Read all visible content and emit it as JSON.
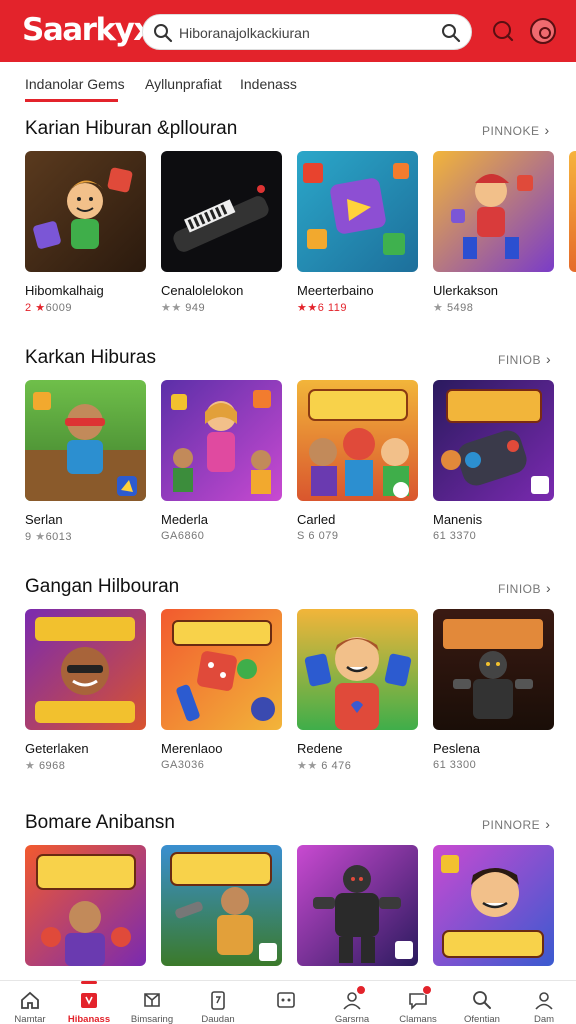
{
  "header": {
    "logo": "Saarkyx",
    "search_placeholder": "Hiboranajolkackiuran",
    "accent_color": "#e3232b"
  },
  "tabs": [
    {
      "label": "Indanolar Gems",
      "active": true
    },
    {
      "label": "Ayllunprafiat",
      "active": false
    },
    {
      "label": "Indenass",
      "active": false
    }
  ],
  "sections": [
    {
      "title": "Karian Hiburan &pllouran",
      "more": "PINNOKE",
      "items": [
        {
          "name": "Hibomkalhaig",
          "rating": "2",
          "meta": "6009",
          "red": true
        },
        {
          "name": "Cenalolelokon",
          "rating": "",
          "meta": "949",
          "red": false
        },
        {
          "name": "Meerterbaino",
          "rating": "",
          "meta": "6 119",
          "red": true
        },
        {
          "name": "Ulerkakson",
          "rating": "",
          "meta": "5498",
          "red": false
        }
      ]
    },
    {
      "title": "Karkan Hiburas",
      "more": "FINIOB",
      "items": [
        {
          "name": "Serlan",
          "rating": "9",
          "meta": "6013",
          "red": false
        },
        {
          "name": "Mederla",
          "rating": "",
          "meta": "GA6860",
          "red": false
        },
        {
          "name": "Carled",
          "rating": "S",
          "meta": "6 079",
          "red": false
        },
        {
          "name": "Manenis",
          "rating": "",
          "meta": "61 3370",
          "red": false
        }
      ]
    },
    {
      "title": "Gangan Hilbouran",
      "more": "FINIOB",
      "items": [
        {
          "name": "Geterlaken",
          "rating": "",
          "meta": "6968",
          "red": false
        },
        {
          "name": "Merenlaoo",
          "rating": "",
          "meta": "GA3036",
          "red": false
        },
        {
          "name": "Redene",
          "rating": "",
          "meta": "6 476",
          "red": false
        },
        {
          "name": "Peslena",
          "rating": "",
          "meta": "61 3300",
          "red": false
        }
      ]
    },
    {
      "title": "Bomare Anibansn",
      "more": "PINNORE",
      "items": [
        {
          "name": "",
          "rating": "",
          "meta": "",
          "red": false
        },
        {
          "name": "",
          "rating": "",
          "meta": "",
          "red": false
        },
        {
          "name": "",
          "rating": "",
          "meta": "",
          "red": false
        },
        {
          "name": "",
          "rating": "",
          "meta": "",
          "red": false
        }
      ]
    }
  ],
  "bottom_nav": [
    {
      "label": "Namtar",
      "icon": "home-icon"
    },
    {
      "label": "Hibanass",
      "icon": "store-icon",
      "active": true
    },
    {
      "label": "Bimsaring",
      "icon": "cube-icon"
    },
    {
      "label": "Daudan",
      "icon": "phone-icon"
    },
    {
      "label": "",
      "icon": "gamepad-icon"
    },
    {
      "label": "Garsrna",
      "icon": "profile-icon",
      "badge": true
    },
    {
      "label": "Clamans",
      "icon": "chat-icon",
      "badge": true
    },
    {
      "label": "Ofentian",
      "icon": "search-icon"
    },
    {
      "label": "Dam",
      "icon": "user-icon"
    }
  ]
}
